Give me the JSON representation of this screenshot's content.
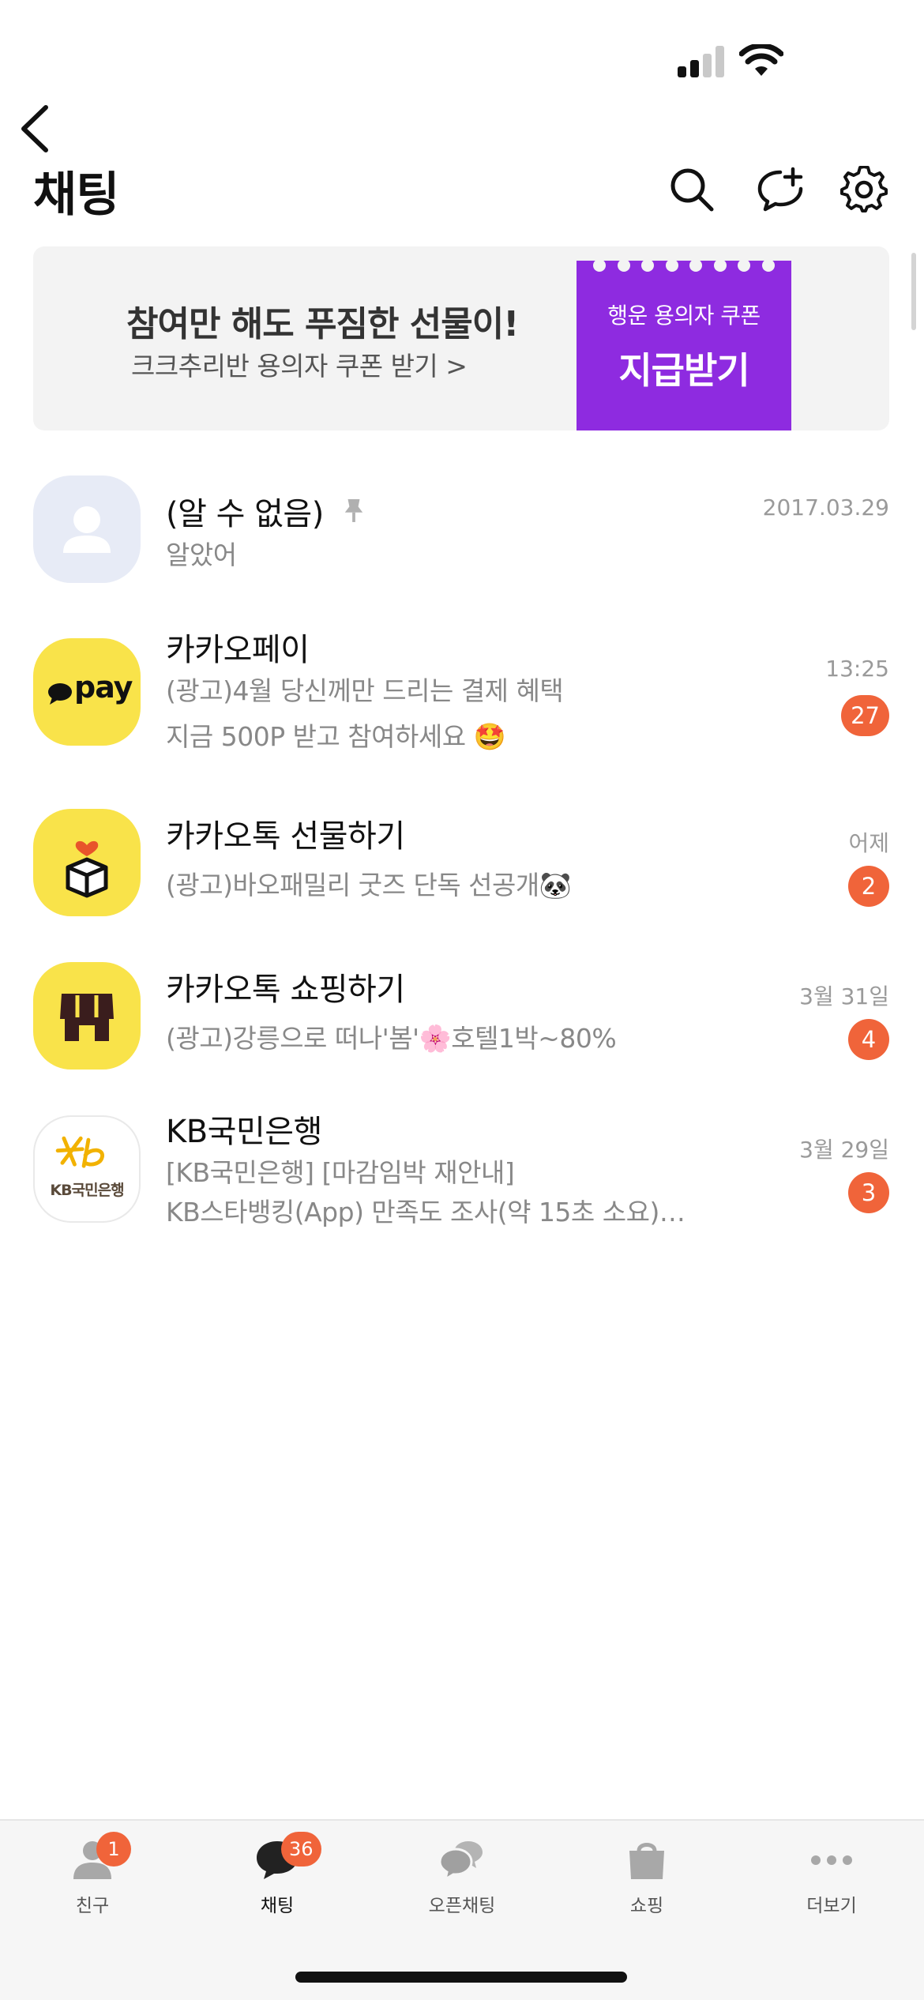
{
  "status_bar": {
    "signal_bars": 4,
    "signal_active": 2
  },
  "header": {
    "title": "채팅"
  },
  "banner": {
    "title": "참여만 해도 푸짐한 선물이!",
    "subtitle": "크크추리반 용의자 쿠폰 받기 >",
    "coupon_caption": "행운 용의자 쿠폰",
    "coupon_cta": "지급받기",
    "coupon_color": "#8e2be0"
  },
  "chats": [
    {
      "name": "(알 수 없음)",
      "pinned": true,
      "messages": [
        "알았어"
      ],
      "time": "2017.03.29",
      "unread": "",
      "avatar_icon": "unknown-person-icon"
    },
    {
      "name": "카카오페이",
      "pinned": false,
      "messages": [
        "(광고)4월 당신께만 드리는 결제 혜택",
        "지금 500P 받고 참여하세요 🤩"
      ],
      "time": "13:25",
      "unread": "27",
      "avatar_icon": "kakaopay-logo",
      "avatar_text": "pay"
    },
    {
      "name": "카카오톡 선물하기",
      "pinned": false,
      "messages": [
        "(광고)바오패밀리 굿즈 단독 선공개🐼"
      ],
      "time": "어제",
      "unread": "2",
      "avatar_icon": "gift-box-icon"
    },
    {
      "name": "카카오톡 쇼핑하기",
      "pinned": false,
      "messages": [
        "(광고)강릉으로 떠나'봄'🌸호텔1박~80%"
      ],
      "time": "3월 31일",
      "unread": "4",
      "avatar_icon": "storefront-icon"
    },
    {
      "name": "KB국민은행",
      "pinned": false,
      "messages": [
        "[KB국민은행] [마감임박 재안내]",
        "KB스타뱅킹(App) 만족도 조사(약 15초 소요)…"
      ],
      "time": "3월 29일",
      "unread": "3",
      "avatar_icon": "kb-logo",
      "avatar_text": "KB국민은행"
    }
  ],
  "tabs": [
    {
      "label": "친구",
      "badge": "1",
      "icon": "person-icon",
      "active": false
    },
    {
      "label": "채팅",
      "badge": "36",
      "icon": "chat-bubble-icon",
      "active": true
    },
    {
      "label": "오픈채팅",
      "badge": "",
      "icon": "open-chat-icon",
      "active": false
    },
    {
      "label": "쇼핑",
      "badge": "",
      "icon": "shopping-bag-icon",
      "active": false
    },
    {
      "label": "더보기",
      "badge": "",
      "icon": "more-dots-icon",
      "active": false
    }
  ],
  "colors": {
    "badge": "#f0643a",
    "kakao_yellow": "#f9e34a",
    "kb_gold": "#f2b200"
  }
}
